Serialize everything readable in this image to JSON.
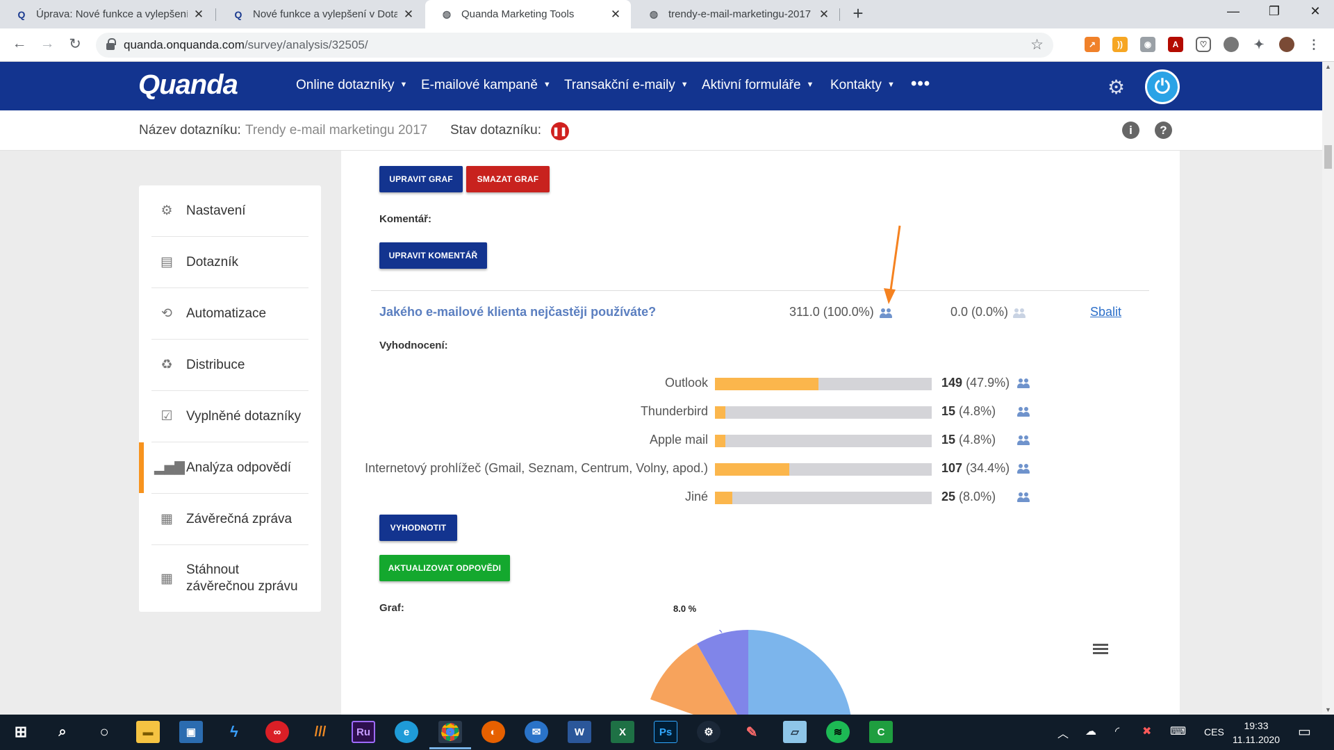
{
  "browser": {
    "tabs": [
      {
        "title": "Úprava: Nové funkce a vylepšení",
        "active": false,
        "favicon": "Q"
      },
      {
        "title": "Nové funkce a vylepšení v Dotazn",
        "active": false,
        "favicon": "Q"
      },
      {
        "title": "Quanda Marketing Tools",
        "active": true,
        "favicon": "globe-icon"
      },
      {
        "title": "trendy-e-mail-marketingu-2017",
        "active": false,
        "favicon": "globe-icon"
      }
    ],
    "url_host": "quanda.onquanda.com",
    "url_path": "/survey/analysis/32505/"
  },
  "app": {
    "logo": "Quanda",
    "menu": [
      {
        "label": "Online dotazníky"
      },
      {
        "label": "E-mailové kampaně"
      },
      {
        "label": "Transakční e-maily"
      },
      {
        "label": "Aktivní formuláře"
      },
      {
        "label": "Kontakty"
      }
    ],
    "more": "•••"
  },
  "survey": {
    "name_label": "Název dotazníku:",
    "name_value": "Trendy e-mail marketingu 2017",
    "status_label": "Stav dotazníku:",
    "status_icon": "pause-icon"
  },
  "sidebar": {
    "items": [
      {
        "label": "Nastavení",
        "icon": "gear-icon"
      },
      {
        "label": "Dotazník",
        "icon": "document-icon"
      },
      {
        "label": "Automatizace",
        "icon": "repeat-icon"
      },
      {
        "label": "Distribuce",
        "icon": "recycle-icon"
      },
      {
        "label": "Vyplněné dotazníky",
        "icon": "checklist-icon"
      },
      {
        "label": "Analýza odpovědí",
        "icon": "bar-chart-icon",
        "active": true
      },
      {
        "label": "Závěrečná zpráva",
        "icon": "report-icon"
      },
      {
        "label": "Stáhnout závěrečnou zprávu",
        "icon": "download-report-icon"
      }
    ]
  },
  "main": {
    "edit_chart": "UPRAVIT GRAF",
    "delete_chart": "SMAZAT GRAF",
    "comment_label": "Komentář:",
    "edit_comment": "UPRAVIT KOMENTÁŘ",
    "question": "Jakého e-mailové klienta nejčastěji používáte?",
    "answered": "311.0 (100.0%)",
    "unanswered": "0.0 (0.0%)",
    "collapse": "Sbalit",
    "evaluation_label": "Vyhodnocení:",
    "evaluate_button": "VYHODNOTIT",
    "update_button": "AKTUALIZOVAT ODPOVĚDI",
    "chart_label": "Graf:",
    "pie_label": "8.0 %"
  },
  "chart_data": {
    "type": "bar",
    "categories": [
      "Outlook",
      "Thunderbird",
      "Apple mail",
      "Internetový prohlížeč (Gmail, Seznam, Centrum, Volny, apod.)",
      "Jiné"
    ],
    "values": [
      149,
      15,
      15,
      107,
      25
    ],
    "percent_labels": [
      "(47.9%)",
      "(4.8%)",
      "(4.8%)",
      "(34.4%)",
      "(8.0%)"
    ],
    "percents": [
      47.9,
      4.8,
      4.8,
      34.4,
      8.0
    ],
    "bar_color": "#fbb64c",
    "track_color": "#d4d4d8"
  },
  "colors": {
    "nav": "#13348f",
    "accent": "#f7931e",
    "link": "#2c6fc9",
    "arrow": "#f58220"
  },
  "taskbar": {
    "apps": [
      "windows-start-icon",
      "search-icon",
      "cortana-icon",
      "file-explorer-icon",
      "store-icon",
      "sourcetree-icon",
      "creative-cloud-icon",
      "app-icon",
      "rush-icon",
      "edge-icon",
      "chrome-icon",
      "firefox-icon",
      "thunderbird-icon",
      "word-icon",
      "excel-icon",
      "photoshop-icon",
      "steam-icon",
      "paint-icon",
      "notepad-icon",
      "spotify-icon",
      "camtasia-icon"
    ],
    "lang": "CES",
    "time": "19:33",
    "date": "11.11.2020"
  }
}
